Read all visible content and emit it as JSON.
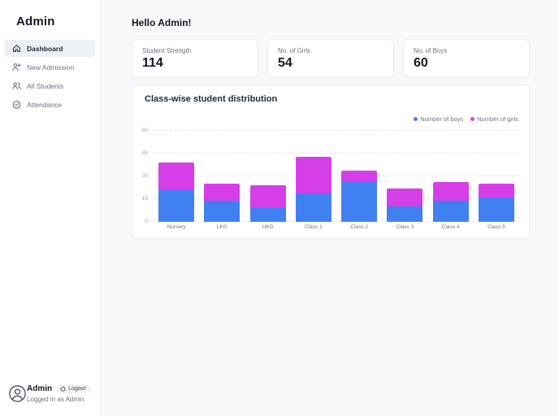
{
  "sidebar": {
    "title": "Admin",
    "items": [
      {
        "label": "Dashboard",
        "icon": "home-icon",
        "active": true
      },
      {
        "label": "New Admission",
        "icon": "user-plus-icon",
        "active": false
      },
      {
        "label": "All Students",
        "icon": "users-icon",
        "active": false
      },
      {
        "label": "Attendance",
        "icon": "badge-check-icon",
        "active": false
      }
    ],
    "user": {
      "name": "Admin",
      "logout_label": "Logout",
      "status": "Logged in as Admin"
    }
  },
  "main": {
    "greeting": "Hello Admin!",
    "stats": [
      {
        "label": "Student Strength",
        "value": "114"
      },
      {
        "label": "No. of Girls",
        "value": "54"
      },
      {
        "label": "No. of Boys",
        "value": "60"
      }
    ]
  },
  "chart_data": {
    "type": "bar",
    "stacked": true,
    "title": "Class-wise student distribution",
    "categories": [
      "Nursery",
      "LKG",
      "UKG",
      "Class 1",
      "Class 2",
      "Class 3",
      "Class 4",
      "Class 5"
    ],
    "series": [
      {
        "name": "Number of boys",
        "color": "#4080f0",
        "values": [
          21,
          14,
          9,
          19,
          26,
          10,
          14,
          16
        ]
      },
      {
        "name": "Number of girls",
        "color": "#d63fe8",
        "values": [
          18,
          11,
          15,
          24,
          8,
          12,
          12,
          9
        ]
      }
    ],
    "xlabel": "",
    "ylabel": "",
    "yticks": [
      0,
      15,
      30,
      45,
      60
    ],
    "ylim": [
      0,
      60
    ],
    "legend_position": "top-right",
    "grid": "dashed-horizontal"
  }
}
